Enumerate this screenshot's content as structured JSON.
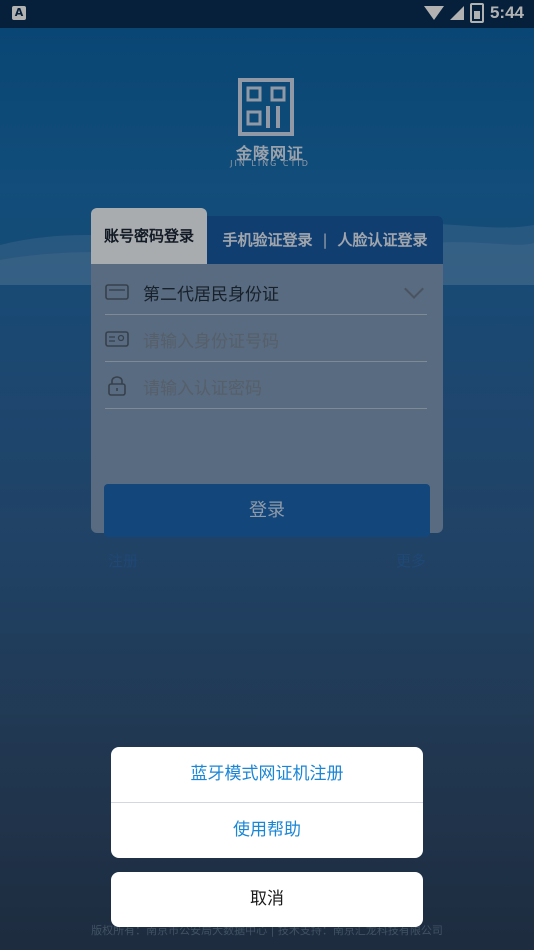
{
  "status_bar": {
    "time": "5:44",
    "notification_icon": "A"
  },
  "logo": {
    "name": "金陵网证",
    "subtitle": "JIN LING CTID"
  },
  "login": {
    "tabs": [
      "账号密码登录",
      "手机验证登录",
      "人脸认证登录"
    ],
    "tab_separator": "|",
    "id_type": "第二代居民身份证",
    "id_placeholder": "请输入身份证号码",
    "password_placeholder": "请输入认证密码",
    "login_button": "登录",
    "register_link": "注册",
    "more_link": "更多"
  },
  "footer": {
    "copyright": "版权所有：南京市公安局大数据中心 | 技术支持：南京汇龙科技有限公司"
  },
  "action_sheet": {
    "items": [
      "蓝牙模式网证机注册",
      "使用帮助"
    ],
    "cancel": "取消"
  },
  "colors": {
    "accent": "#1a86d6",
    "primary_dark": "#1859a3"
  }
}
